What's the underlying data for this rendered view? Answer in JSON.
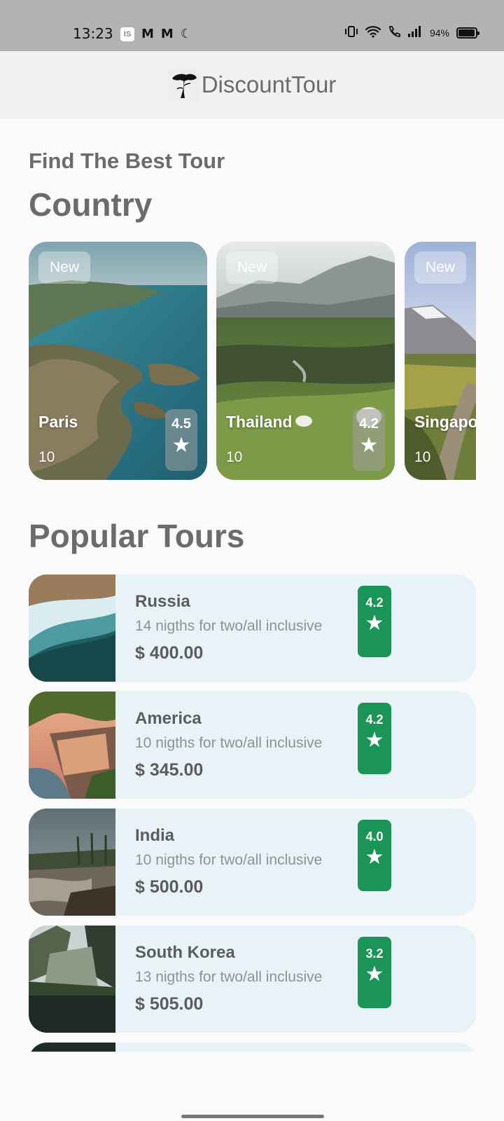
{
  "status_bar": {
    "time": "13:23",
    "notif_badge": "IS",
    "notif_icons": [
      "M",
      "M",
      "☾"
    ],
    "battery_text": "94%",
    "battery_level": 0.94
  },
  "app_bar": {
    "title": "DiscountTour",
    "logo_icon": "tree-logo-icon"
  },
  "find": {
    "subtitle": "Find The Best Tour",
    "country_heading": "Country",
    "popular_heading": "Popular Tours"
  },
  "countries": [
    {
      "tag": "New",
      "name": "Paris",
      "count": "10",
      "rating": "4.5"
    },
    {
      "tag": "New",
      "name": "Thailand",
      "count": "10",
      "rating": "4.2"
    },
    {
      "tag": "New",
      "name": "Singapore",
      "count": "10",
      "rating": ""
    }
  ],
  "tours": [
    {
      "name": "Russia",
      "desc": "14 nigths for two/all inclusive",
      "price": "$ 400.00",
      "rating": "4.2"
    },
    {
      "name": "America",
      "desc": "10 nigths for two/all inclusive",
      "price": "$ 345.00",
      "rating": "4.2"
    },
    {
      "name": "India",
      "desc": "10 nigths for two/all inclusive",
      "price": "$ 500.00",
      "rating": "4.0"
    },
    {
      "name": "South Korea",
      "desc": "13 nigths for two/all inclusive",
      "price": "$ 505.00",
      "rating": "3.2"
    }
  ],
  "colors": {
    "accent_green": "#1b9458",
    "card_bg": "#e8f3f7",
    "heading_gray": "#6b6b6b"
  }
}
